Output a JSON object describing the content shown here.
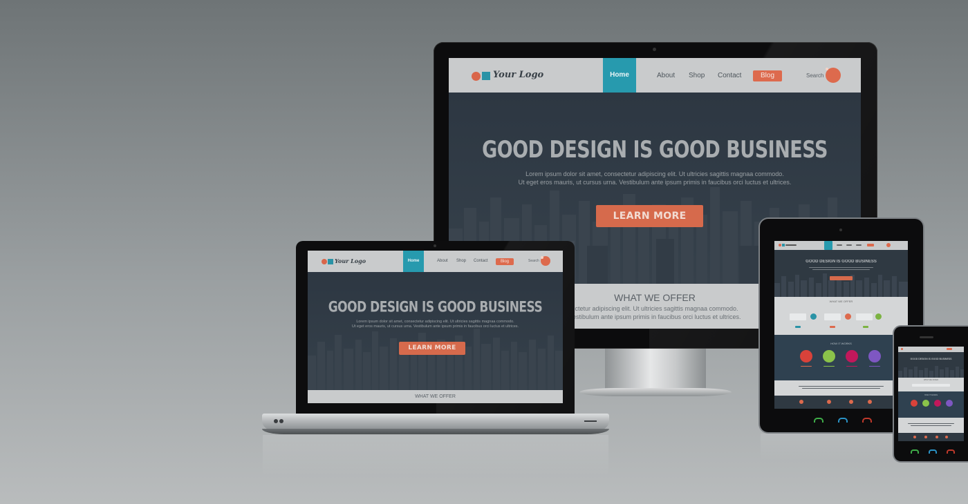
{
  "site": {
    "logo_text": "Your Logo",
    "nav": {
      "home": "Home",
      "about": "About",
      "shop": "Shop",
      "contact": "Contact",
      "blog": "Blog",
      "search": "Search"
    },
    "hero": {
      "title": "GOOD DESIGN IS GOOD BUSINESS",
      "subtitle_line1": "Lorem ipsum dolor sit amet, consectetur adipiscing elit. Ut ultricies sagittis magnaa commodo.",
      "subtitle_line2": "Ut eget eros mauris, ut cursus urna. Vestibulum ante ipsum primis in faucibus orci luctus et ultrices.",
      "cta": "LEARN MORE"
    },
    "offer": {
      "title": "WHAT WE OFFER",
      "text_line1": "ectetur adipiscing elit. Ut ultricies sagittis magnaa commodo.",
      "text_line2": "Vestibulum ante ipsum primis in faucibus orci luctus et ultrices."
    },
    "how_it_works": "HOW IT WORKS"
  },
  "colors": {
    "accent_teal": "#279aae",
    "accent_orange": "#dd6a4d",
    "hero_dark": "#2e3841",
    "nav_light": "#c9cbcc"
  },
  "icons": {
    "search": "search-icon",
    "logo_dot": "logo-circle-icon",
    "logo_square": "logo-square-icon"
  }
}
